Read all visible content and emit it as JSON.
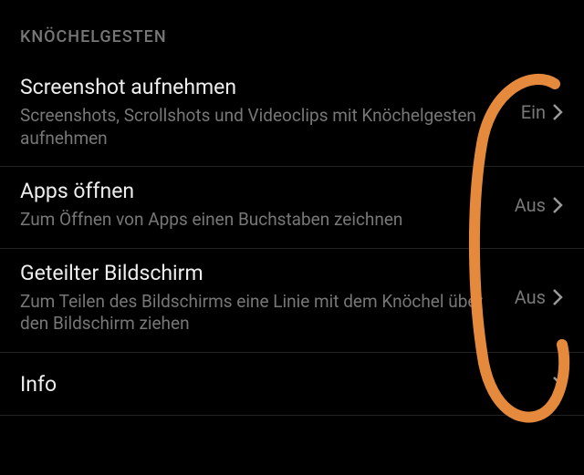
{
  "section_header": "KNÖCHELGESTEN",
  "rows": [
    {
      "title": "Screenshot aufnehmen",
      "desc": "Screenshots, Scrollshots und Videoclips mit Knöchelgesten aufnehmen",
      "value": "Ein"
    },
    {
      "title": "Apps öffnen",
      "desc": "Zum Öffnen von Apps einen Buchstaben zeichnen",
      "value": "Aus"
    },
    {
      "title": "Geteilter Bildschirm",
      "desc": "Zum Teilen des Bildschirms eine Linie mit dem Knöchel über den Bildschirm ziehen",
      "value": "Aus"
    },
    {
      "title": "Info",
      "desc": "",
      "value": ""
    }
  ]
}
